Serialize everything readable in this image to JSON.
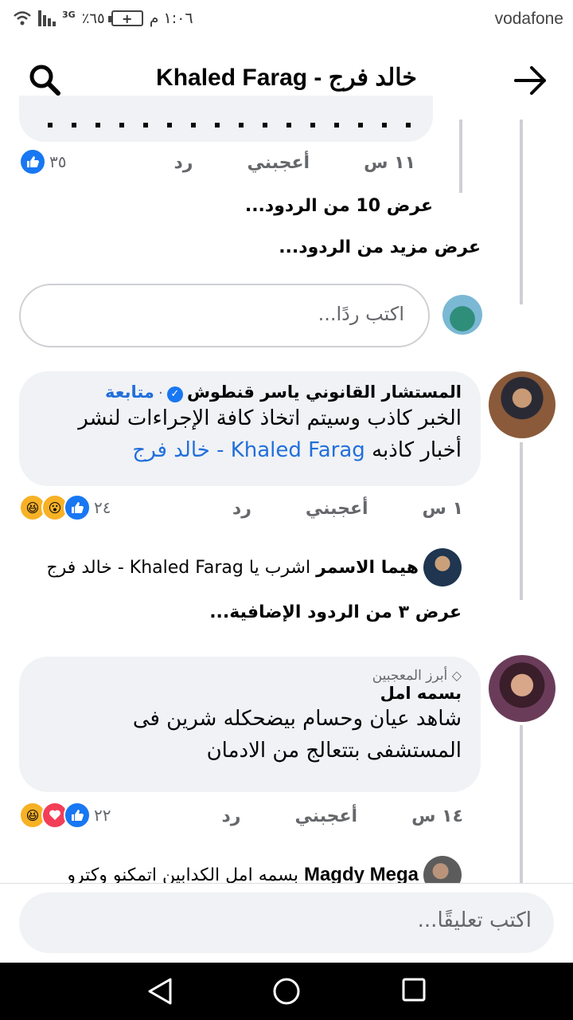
{
  "status_bar": {
    "time": "١:٠٦ م",
    "battery": "٦٥٪",
    "network": "3G",
    "carrier": "vodafone"
  },
  "header": {
    "title": "Khaled Farag - خالد فرج"
  },
  "top_comment": {
    "time": "١١ س",
    "like": "أعجبني",
    "reply": "رد",
    "reaction_count": "٣٥"
  },
  "view_replies_10": "عرض 10 من الردود...",
  "view_more_replies": "عرض مزيد من الردود...",
  "reply_placeholder": "اكتب ردًا...",
  "comment_1": {
    "name": "المستشار القانوني  ياسر قنطوش",
    "follow": "متابعة",
    "separator": "·",
    "text": "الخبر كاذب وسيتم اتخاذ كافة الإجراءات لنشر أخبار كاذبه",
    "mention": "Khaled Farag - خالد فرج",
    "time": "١ س",
    "like": "أعجبني",
    "reply": "رد",
    "reaction_count": "٢٤"
  },
  "reply_1": {
    "name": "هيما الاسمر",
    "text": "اشرب يا",
    "mention": "Khaled Farag - خالد فرج"
  },
  "view_replies_3": "عرض ٣ من الردود الإضافية...",
  "comment_2": {
    "badge": "أبرز المعجبين",
    "name": "بسمه امل",
    "text": "شاهد عيان وحسام بيضحكله شرين فى المستشفى بتتعالج من الادمان",
    "time": "١٤ س",
    "like": "أعجبني",
    "reply": "رد",
    "reaction_count": "٢٢"
  },
  "reply_2": {
    "name": "Magdy Mega",
    "text": "بسمه امل الكدابين اتمكنو وكترو"
  },
  "comment_placeholder": "اكتب تعليقًا...",
  "colors": {
    "accent": "#216fdb",
    "like": "#1877f2",
    "love": "#f33e58",
    "haha": "#f7b125",
    "bubble": "#f0f2f5"
  }
}
